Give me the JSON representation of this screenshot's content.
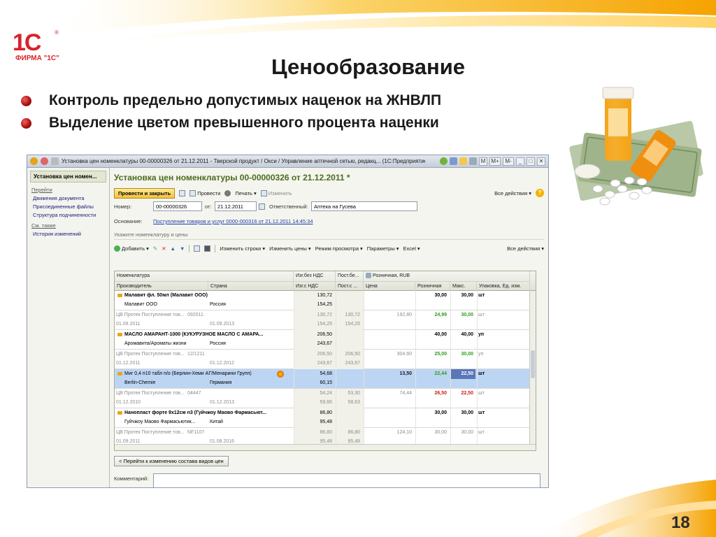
{
  "slide": {
    "title": "Ценообразование",
    "bullets": [
      "Контроль предельно допустимых наценок на ЖНВЛП",
      "Выделение цветом превышенного процента наценки"
    ],
    "page_number": "18",
    "logo": {
      "mark": "1С",
      "text": "ФИРМА \"1С\""
    }
  },
  "colors": {
    "accent_orange": "#f5a300",
    "brand_red": "#d8232a",
    "doc_title_green": "#4a6b1e",
    "exceeded_markup": "#d11a1a",
    "ok_markup": "#2e9e1a",
    "selected_row": "#bcd5f3"
  },
  "window": {
    "title": "Установка цен номенклатуры 00-00000326 от 21.12.2011 - Тверской продукт / Окси / Управление аптечной сетью, редакц... (1С:Предприятие)",
    "controls": [
      "M",
      "M+",
      "M-",
      "_",
      "□",
      "✕"
    ]
  },
  "side": {
    "header": "Установка цен номен...",
    "section_go": "Перейти",
    "links": [
      "Движения документа",
      "Присоединенные файлы",
      "Структура подчиненности"
    ],
    "section_see_also": "См. также",
    "see_also_links": [
      "История изменений"
    ]
  },
  "doc": {
    "title": "Установка цен номенклатуры 00-00000326 от 21.12.2011 *",
    "cmd_primary": "Провести и закрыть",
    "cmd_post": "Провести",
    "cmd_print": "Печать",
    "cmd_edit": "Изменить",
    "cmd_all_actions": "Все действия",
    "number_label": "Номер:",
    "number_value": "00-00000326",
    "date_label": "от:",
    "date_value": "21.12.2011",
    "responsible_label": "Ответственный:",
    "responsible_value": "Аптека на Гусева",
    "basis_label": "Основание:",
    "basis_link": "Поступление товаров и услуг 0000-000316 от 21.12.2011 14:45:34",
    "section_title": "Укажите номенклатуру и цены",
    "table_toolbar": {
      "add": "Добавить",
      "change_rows": "Изменить строки",
      "change_prices": "Изменить цены",
      "view_mode": "Режим просмотра",
      "params": "Параметры",
      "excel": "Excel",
      "all_actions": "Все действия"
    },
    "back_button": "< Перейти к изменению состава видов цен",
    "comment_label": "Комментарий:"
  },
  "grid": {
    "headers_row1": [
      "Номенклатура",
      "Изг.без НДС",
      "Пост.бе...",
      "Розничная, RUB"
    ],
    "headers_row2": [
      "Производитель",
      "Страна",
      "Изг.с НДС",
      "Пост.с ...",
      "Цена",
      "Розничная",
      "Макс.",
      "Упаковка, Ед. изм."
    ],
    "rows": [
      {
        "kind": "item",
        "name": "Малавит фл. 50мл (Малавит ООО)",
        "maker": "Малавит ООО",
        "country": "Россия",
        "izg_bez": "130,72",
        "izg_s": "154,25",
        "post_bez": "",
        "post_s": "",
        "price": "",
        "retail": "30,00",
        "retail_class": "bold",
        "max": "30,00",
        "unit": "шт"
      },
      {
        "kind": "sub",
        "name": "ЦВ Протек Поступление тов...",
        "maker": "01.09.2011",
        "num": "092011",
        "date2": "01.09.2013",
        "izg_bez": "130,72",
        "izg_s": "154,25",
        "post_bez": "130,72",
        "post_s": "154,25",
        "price": "192,80",
        "retail": "24,99",
        "retail_class": "green",
        "max": "30,00",
        "unit": "шт"
      },
      {
        "kind": "item",
        "name": "МАСЛО АМАРАНТ-1000 (КУКУРУЗНОЕ МАСЛО С АМАРА...",
        "maker": "Аромавита/Ароматы жизни",
        "country": "Россия",
        "izg_bez": "206,50",
        "izg_s": "243,67",
        "post_bez": "",
        "post_s": "",
        "price": "",
        "retail": "40,00",
        "retail_class": "bold",
        "max": "40,00",
        "unit": "уп"
      },
      {
        "kind": "sub",
        "name": "ЦВ Протек Поступление тов...",
        "maker": "01.12.2011",
        "num": "12/1211",
        "date2": "01.12.2012",
        "izg_bez": "206,50",
        "izg_s": "243,67",
        "post_bez": "206,50",
        "post_s": "243,67",
        "price": "304,60",
        "retail": "25,00",
        "retail_class": "green",
        "max": "30,00",
        "unit": "уп"
      },
      {
        "kind": "item",
        "selected": true,
        "name": "Миг 0,4 п10 табл п/о (Берлин-Хеми АГ/Менарини Групп)",
        "maker": "Berlin-Chemie",
        "country": "Германия",
        "izg_bez": "54,68",
        "izg_s": "60,15",
        "post_bez": "",
        "post_s": "",
        "price": "13,50",
        "retail": "22,44",
        "retail_class": "green",
        "max": "22,50",
        "unit": "шт"
      },
      {
        "kind": "sub",
        "name": "ЦВ Протек Поступление тов...",
        "maker": "01.12.2010",
        "num": "04447",
        "date2": "01.12.2013",
        "izg_bez": "54,24",
        "izg_s": "59,66",
        "post_bez": "53,30",
        "post_s": "58,63",
        "price": "74,44",
        "retail": "26,50",
        "retail_class": "red",
        "max": "22,50",
        "unit": "шт"
      },
      {
        "kind": "item",
        "name": "Нанопласт форте 9х12см n3 (Гуйчжоу Маово Фармасьют...",
        "maker": "Гуйчжоу Маово Фармасьютик...",
        "country": "Китай",
        "izg_bez": "86,80",
        "izg_s": "95,48",
        "post_bez": "",
        "post_s": "",
        "price": "",
        "retail": "30,00",
        "retail_class": "bold",
        "max": "30,00",
        "unit": "шт"
      },
      {
        "kind": "sub",
        "name": "ЦВ Протек Поступление тов...",
        "maker": "01.09.2011",
        "num": "NF1107",
        "date2": "01.08.2016",
        "izg_bez": "86,80",
        "izg_s": "95,48",
        "post_bez": "86,80",
        "post_s": "95,48",
        "price": "124,10",
        "retail": "30,00",
        "retail_class": "",
        "max": "30,00",
        "unit": "шт"
      }
    ]
  }
}
